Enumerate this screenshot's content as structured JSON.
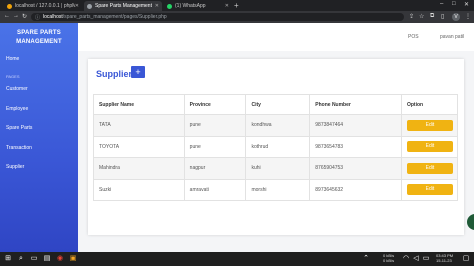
{
  "browser": {
    "tabs": [
      {
        "title": "localhost / 127.0.0.1 | phpMyAdr",
        "active": false
      },
      {
        "title": "Spare Parts Management",
        "active": true
      },
      {
        "title": "(1) WhatsApp",
        "active": false
      }
    ],
    "new_tab": "+",
    "url_host": "localhost",
    "url_path": "/spare_parts_management/pages/Supplier.php",
    "profile_initial": "V"
  },
  "sidebar": {
    "brand_line1": "SPARE PARTS",
    "brand_line2": "MANAGEMENT",
    "home": "Home",
    "section_heading": "PAGES",
    "items": [
      "Customer",
      "Employee",
      "Spare Parts",
      "Transaction",
      "Supplier"
    ]
  },
  "topbar": {
    "pos": "POS",
    "user": "pavan patil"
  },
  "supplier": {
    "title": "Supplier",
    "add_button": "+",
    "columns": [
      "Supplier Name",
      "Province",
      "City",
      "Phone Number",
      "Option"
    ],
    "rows": [
      {
        "name": "TATA",
        "province": "pune",
        "city": "kondhwa",
        "phone": "9873847464",
        "option": "Edit"
      },
      {
        "name": "TOYOTA",
        "province": "pune",
        "city": "kothrud",
        "phone": "9873654783",
        "option": "Edit"
      },
      {
        "name": "Mahindra",
        "province": "nagpur",
        "city": "kuhi",
        "phone": "8765904753",
        "option": "Edit"
      },
      {
        "name": "Suzki",
        "province": "amravati",
        "city": "morshi",
        "phone": "8973645632",
        "option": "Edit"
      }
    ]
  },
  "taskbar": {
    "net_up": "0 kB/s",
    "net_down": "0 kB/s",
    "time": "03:43 PM",
    "date": "15-11-23"
  },
  "colors": {
    "sidebar": "#3a57d6",
    "accent": "#3a57d6",
    "edit_button": "#f0b312"
  }
}
